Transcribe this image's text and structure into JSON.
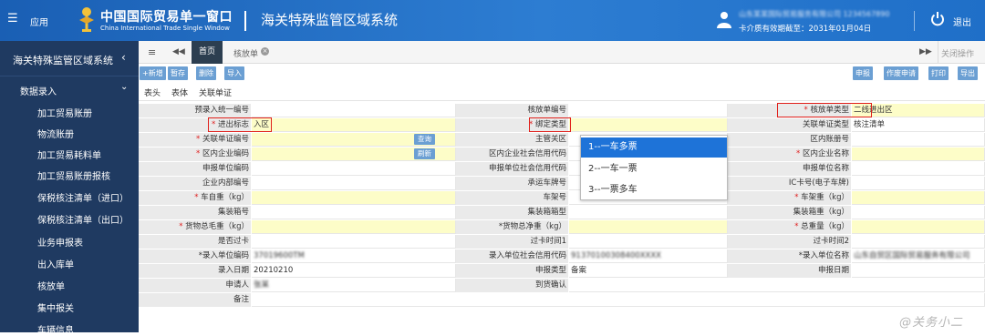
{
  "header": {
    "menu_icon": "list-icon",
    "app_label": "应用",
    "brand_cn": "中国国际贸易单一窗口",
    "brand_en": "China International Trade Single Window",
    "system_title": "海关特殊监管区域系统",
    "user_name": "山东某某国际贸易服务有限公司 1234567890",
    "cert_expiry": "卡介质有效期截至：2031年01月04日",
    "logout": "退出"
  },
  "sidebar": {
    "title": "海关特殊监管区域系统",
    "group": "数据录入",
    "items": [
      "加工贸易账册",
      "物流账册",
      "加工贸易耗料单",
      "加工贸易账册报核",
      "保税核注清单（进口）",
      "保税核注清单（出口）",
      "业务申报表",
      "出入库单",
      "核放单",
      "集中报关",
      "车辆信息"
    ]
  },
  "tabbar": {
    "home": "首页",
    "active_tab": "核放单",
    "close_ops": "关闭操作"
  },
  "toolbar": {
    "left": [
      "+新增",
      "暂存",
      "删除",
      "导入"
    ],
    "right": [
      "申报",
      "作废申请",
      "打印",
      "导出"
    ]
  },
  "subtabs": [
    "表头",
    "表体",
    "关联单证"
  ],
  "form": {
    "r1": [
      "预录入统一编号",
      "",
      "核放单编号",
      "",
      "核放单类型",
      "二线进出区"
    ],
    "r2": [
      "进出标志",
      "入区",
      "绑定类型",
      "",
      "关联单证类型",
      "核注清单"
    ],
    "r3": [
      "关联单证编号",
      "查询",
      "主管关区",
      "",
      "区内账册号",
      ""
    ],
    "r4": [
      "区内企业编码",
      "刷新",
      "区内企业社会信用代码",
      "",
      "区内企业名称",
      ""
    ],
    "r5": [
      "申报单位编码",
      "",
      "申报单位社会信用代码",
      "",
      "申报单位名称",
      ""
    ],
    "r6": [
      "企业内部编号",
      "",
      "承运车牌号",
      "",
      "IC卡号(电子车牌)",
      ""
    ],
    "r7": [
      "车自重（kg）",
      "",
      "车架号",
      "",
      "车架重（kg）",
      ""
    ],
    "r8": [
      "集装箱号",
      "",
      "集装箱箱型",
      "",
      "集装箱重（kg）",
      ""
    ],
    "r9": [
      "货物总毛重（kg）",
      "",
      "*货物总净重（kg）",
      "",
      "总重量（kg）",
      ""
    ],
    "r10": [
      "是否过卡",
      "",
      "过卡时间1",
      "",
      "过卡时间2",
      ""
    ],
    "r11": [
      "*录入单位编码",
      "37019600TM",
      "录入单位社会信用代码",
      "91370100308400XXXX",
      "*录入单位名称",
      "山东自贸区国际贸易服务有限公司"
    ],
    "r12": [
      "录入日期",
      "20210210",
      "申报类型",
      "备案",
      "申报日期",
      ""
    ],
    "r13": [
      "申请人",
      "张某",
      "到货确认",
      "",
      "",
      ""
    ],
    "r14": [
      "备注",
      "",
      "",
      "",
      "",
      ""
    ]
  },
  "dropdown": {
    "options": [
      "1--一车多票",
      "2--一车一票",
      "3--一票多车"
    ],
    "selected_index": 0
  },
  "watermark": "@关务小二",
  "colors": {
    "header_blue": "#2d7dd2",
    "sidebar_navy": "#1f3a61",
    "required_yellow": "#fdfdc8",
    "highlight_red": "#e0201b",
    "dropdown_selected": "#1e73d8"
  }
}
